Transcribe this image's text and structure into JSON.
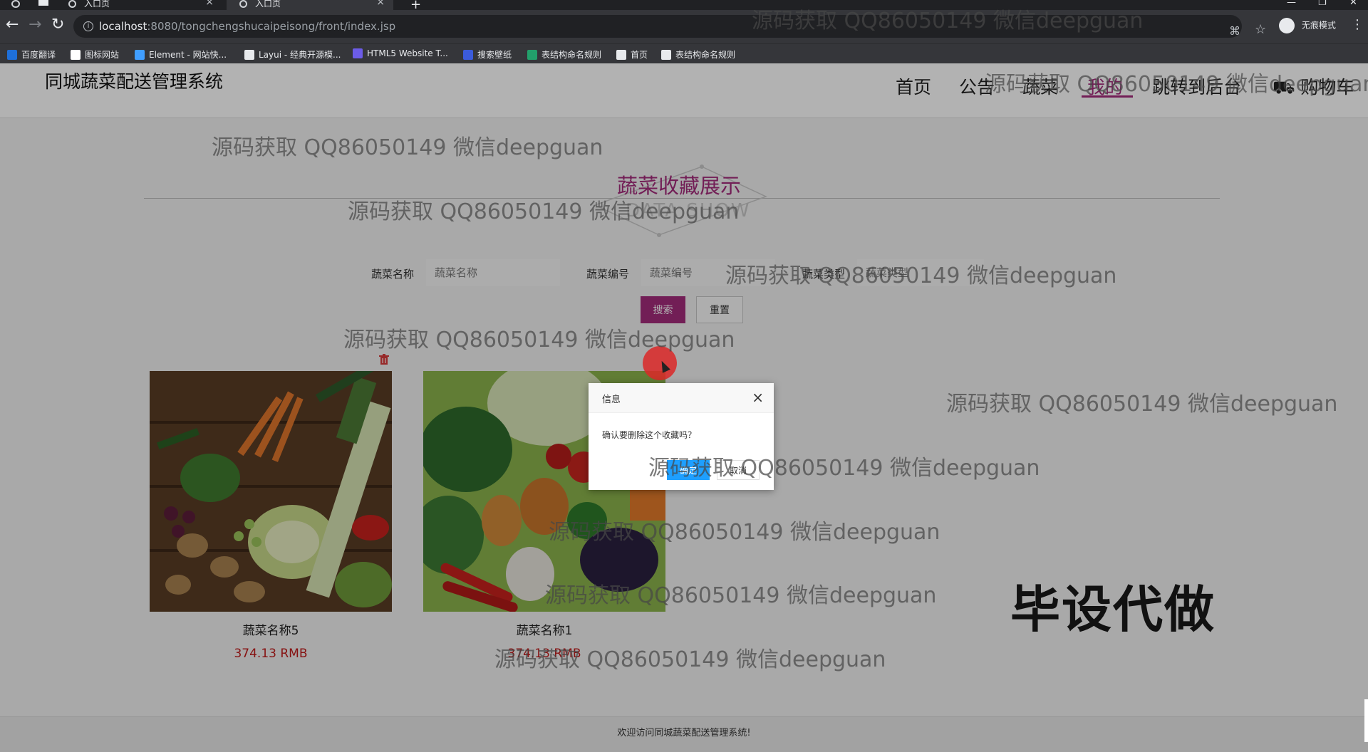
{
  "browser": {
    "tabs": [
      {
        "label": "入口页",
        "active": false
      },
      {
        "label": "入口页",
        "active": true
      }
    ],
    "url_host": "localhost",
    "url_rest": ":8080/tongchengshucaipeisong/front/index.jsp",
    "incognito_label": "无痕模式",
    "bookmarks": [
      {
        "label": "百度翻译",
        "color": "#1e6fd9"
      },
      {
        "label": "图标网站",
        "color": "#ffffff"
      },
      {
        "label": "Element - 网站快...",
        "color": "#409eff"
      },
      {
        "label": "Layui - 经典开源模...",
        "color": "#e8eaed"
      },
      {
        "label": "HTML5 Website T...",
        "color": "#6c5ce7"
      },
      {
        "label": "搜索壁纸",
        "color": "#3b5bdb"
      },
      {
        "label": "表结构命名规则",
        "color": "#22a06b"
      },
      {
        "label": "首页",
        "color": "#e8eaed"
      },
      {
        "label": "表结构命名规则",
        "color": "#e8eaed"
      }
    ]
  },
  "site": {
    "title": "同城蔬菜配送管理系统",
    "nav": [
      "首页",
      "公告",
      "蔬菜",
      "我的",
      "跳转到后台",
      "购物车"
    ],
    "active_nav": "我的",
    "accent_color": "#a42b7c"
  },
  "section": {
    "title": "蔬菜收藏展示",
    "subtitle": "DATA SHOW"
  },
  "search": {
    "name_label": "蔬菜名称",
    "name_placeholder": "蔬菜名称",
    "code_label": "蔬菜编号",
    "code_placeholder": "蔬菜编号",
    "type_label": "蔬菜类型",
    "type_placeholder": "蔬菜类型",
    "search_button": "搜索",
    "reset_button": "重置"
  },
  "items": [
    {
      "name": "蔬菜名称5",
      "price": "374.13 RMB"
    },
    {
      "name": "蔬菜名称1",
      "price": "374.13 RMB"
    }
  ],
  "dialog": {
    "title": "信息",
    "message": "确认要删除这个收藏吗？",
    "ok": "确定",
    "cancel": "取消"
  },
  "footer": "欢迎访问同城蔬菜配送管理系统!",
  "watermark": "源码获取 QQ86050149 微信deepguan",
  "stamp": "毕设代做"
}
